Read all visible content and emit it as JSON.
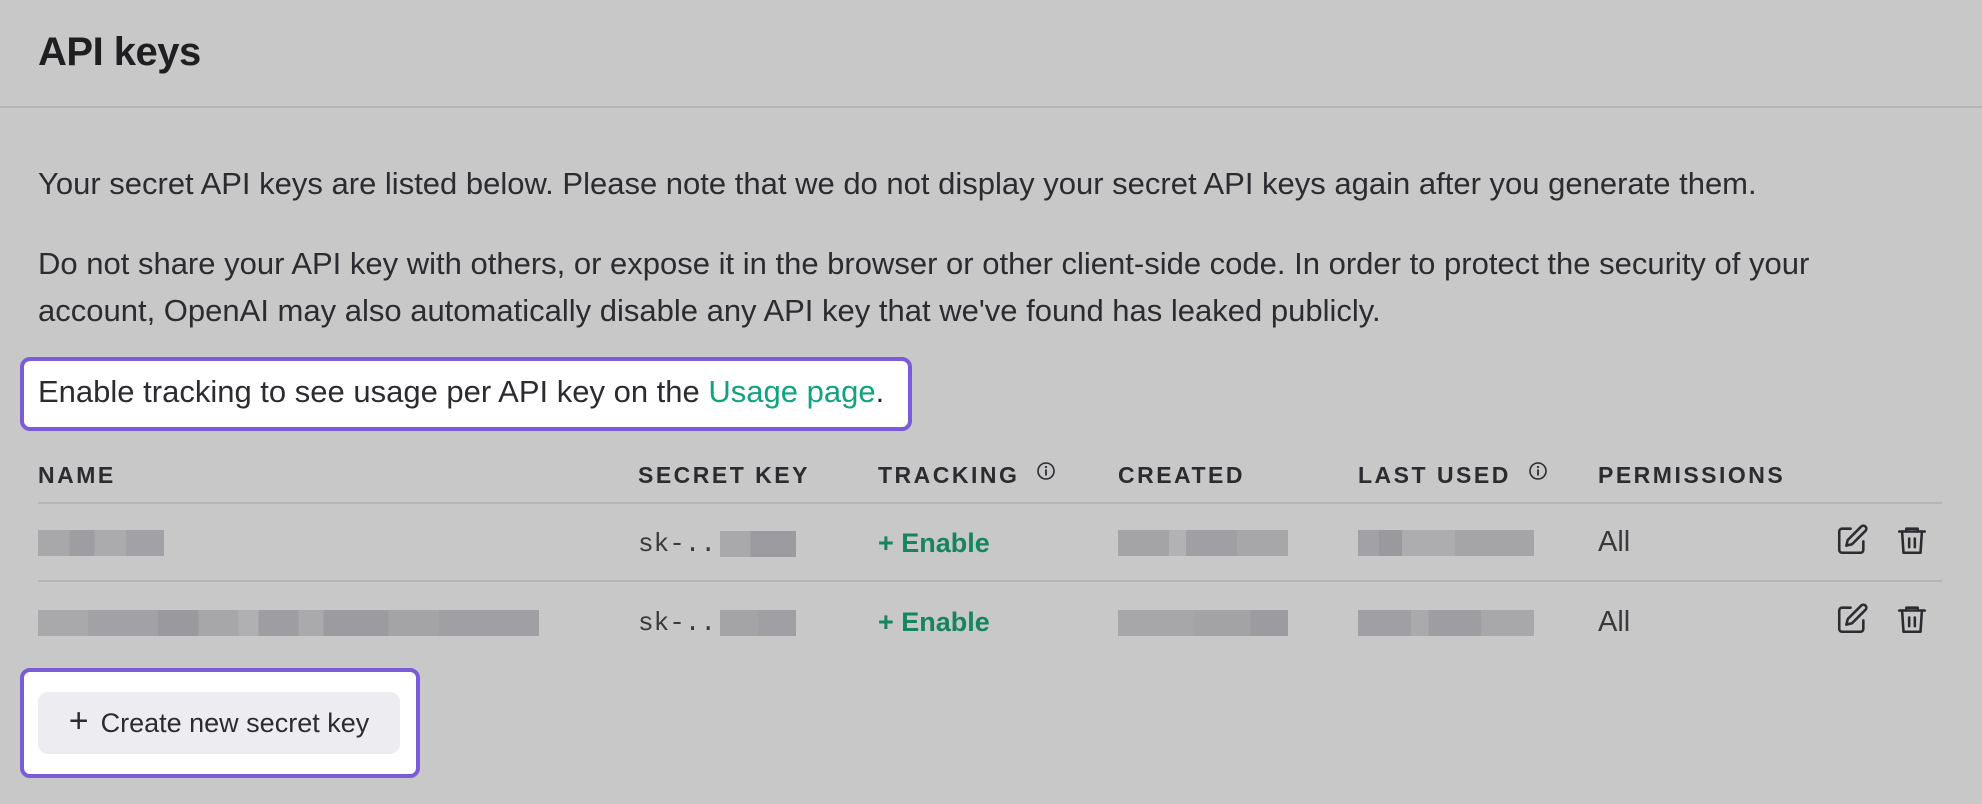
{
  "page": {
    "title": "API keys"
  },
  "intro": {
    "p1": "Your secret API keys are listed below. Please note that we do not display your secret API keys again after you generate them.",
    "p2": "Do not share your API key with others, or expose it in the browser or other client-side code. In order to protect the security of your account, OpenAI may also automatically disable any API key that we've found has leaked publicly."
  },
  "tracking_notice": {
    "text": "Enable tracking to see usage per API key on the ",
    "link": "Usage page",
    "suffix": "."
  },
  "table": {
    "headers": {
      "name": "NAME",
      "secret_key": "SECRET KEY",
      "tracking": "TRACKING",
      "created": "CREATED",
      "last_used": "LAST USED",
      "permissions": "PERMISSIONS"
    },
    "rows": [
      {
        "secret_key_prefix": "sk-..",
        "tracking": "+ Enable",
        "permissions": "All"
      },
      {
        "secret_key_prefix": "sk-..",
        "tracking": "+ Enable",
        "permissions": "All"
      }
    ]
  },
  "create_button": {
    "label": "Create new secret key",
    "icon": "plus-icon"
  },
  "colors": {
    "accent_link": "#10a37f",
    "enable_green": "#16845f",
    "highlight_border": "#7a5cd9",
    "background": "#c8c8c8"
  },
  "icons": [
    "info-icon",
    "edit-icon",
    "trash-icon",
    "plus-icon"
  ]
}
